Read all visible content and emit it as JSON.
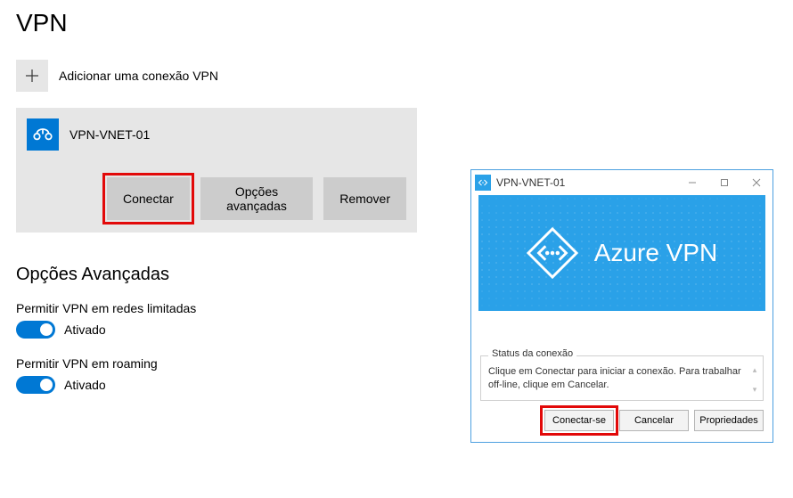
{
  "settings": {
    "page_title": "VPN",
    "add_label": "Adicionar uma conexão VPN",
    "connection": {
      "name": "VPN-VNET-01",
      "buttons": {
        "connect": "Conectar",
        "advanced": "Opções avançadas",
        "remove": "Remover"
      }
    },
    "advanced_section_title": "Opções Avançadas",
    "options": [
      {
        "label": "Permitir VPN em redes limitadas",
        "state_text": "Ativado",
        "on": true
      },
      {
        "label": "Permitir VPN em roaming",
        "state_text": "Ativado",
        "on": true
      }
    ]
  },
  "dialog": {
    "title": "VPN-VNET-01",
    "banner_text": "Azure VPN",
    "status_legend": "Status da conexão",
    "status_message": "Clique em Conectar para iniciar a conexão. Para trabalhar off-line, clique em Cancelar.",
    "buttons": {
      "connect": "Conectar-se",
      "cancel": "Cancelar",
      "properties": "Propriedades"
    }
  },
  "colors": {
    "azure_blue": "#2aa1e8",
    "win_accent": "#0078d4",
    "highlight": "#e20909"
  }
}
